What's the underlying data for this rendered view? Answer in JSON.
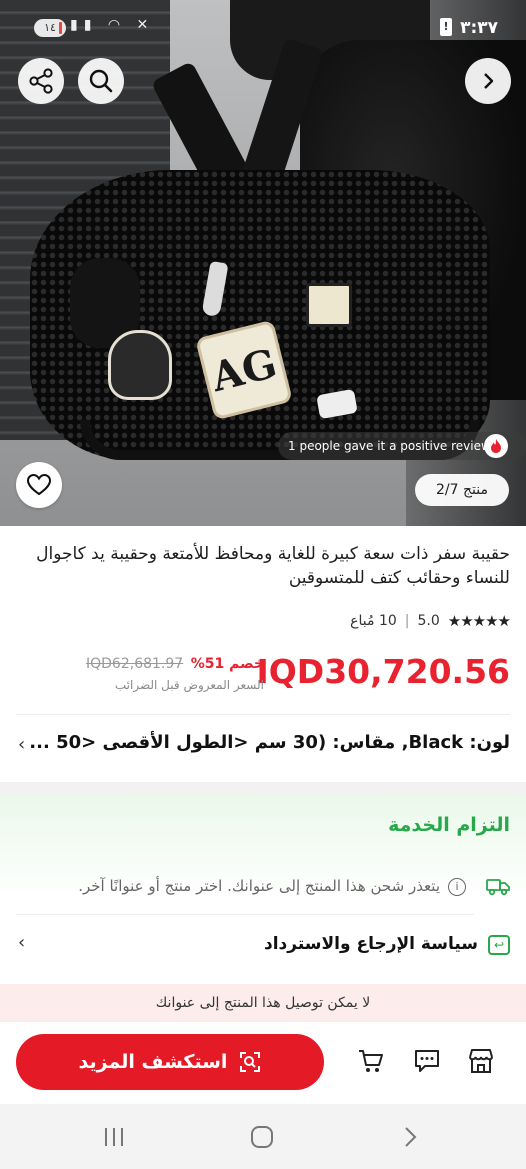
{
  "status_bar": {
    "time": "٣:٣٧",
    "battery_level": "١٤"
  },
  "gallery": {
    "review_text": "1 people gave it a positive review",
    "counter_label": "منتج 2/7",
    "badge_text": "AG"
  },
  "product": {
    "title": "حقيبة سفر ذات سعة كبيرة للغاية ومحافظ للأمتعة وحقيبة يد كاجوال للنساء وحقائب كتف للمتسوقين",
    "rating": "5.0",
    "sold_text": "10 مُباع",
    "price": "IQD30,720.56",
    "discount": "خصم 51%",
    "old_price": "IQD62,681.97",
    "tax_note": "السعر المعروض قبل الضرائب",
    "variant_text": "لون: Black, مقاس: (30 سم <الطول الأقصى <50 ..."
  },
  "service": {
    "title": "التزام الخدمة",
    "shipping_text": "يتعذر شحن هذا المنتج إلى عنوانك. اختر منتج أو عنوانًا آخر.",
    "return_policy": "سياسة الإرجاع والاسترداد"
  },
  "notice": {
    "no_delivery": "لا يمكن توصيل هذا المنتج إلى عنوانك"
  },
  "actions": {
    "explore_label": "استكشف المزيد"
  },
  "colors": {
    "accent_red": "#e41a27",
    "price_red": "#e8232f",
    "service_green": "#27a84a"
  },
  "icons": [
    "share-icon",
    "search-icon",
    "chevron-right-icon",
    "heart-icon",
    "fire-icon",
    "truck-icon",
    "info-icon",
    "return-icon",
    "chevron-left-icon",
    "cart-icon",
    "chat-icon",
    "store-icon",
    "scan-icon"
  ]
}
